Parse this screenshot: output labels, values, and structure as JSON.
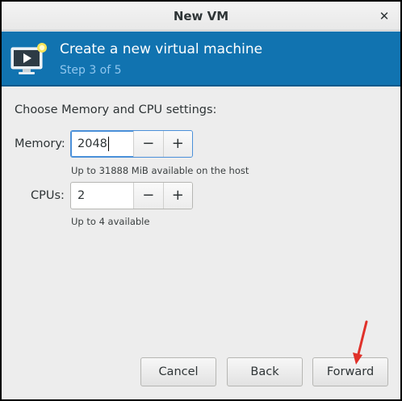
{
  "window": {
    "title": "New VM",
    "close_icon": "close-icon"
  },
  "banner": {
    "heading": "Create a new virtual machine",
    "step": "Step 3 of 5",
    "icon": "computer-screen-icon",
    "background_color": "#1173b0"
  },
  "form": {
    "prompt": "Choose Memory and CPU settings:",
    "memory": {
      "label": "Memory:",
      "value": "2048",
      "decrement": "−",
      "increment": "+",
      "hint": "Up to 31888 MiB available on the host"
    },
    "cpus": {
      "label": "CPUs:",
      "value": "2",
      "decrement": "−",
      "increment": "+",
      "hint": "Up to 4 available"
    }
  },
  "buttons": {
    "cancel": "Cancel",
    "back": "Back",
    "forward": "Forward"
  },
  "annotation": {
    "arrow_color": "#e0312a"
  }
}
